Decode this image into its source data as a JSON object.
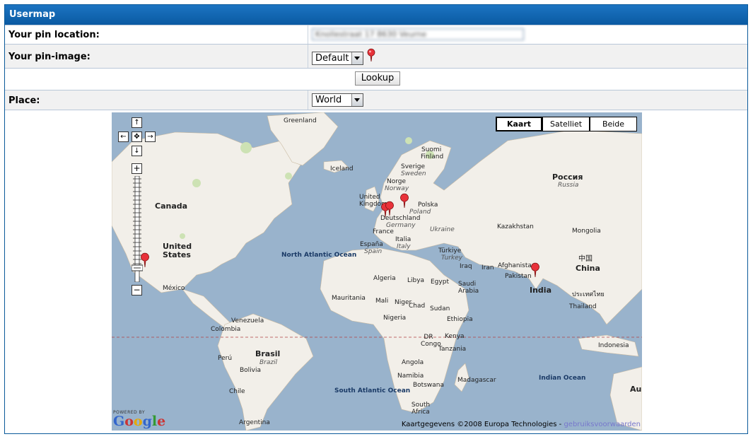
{
  "panel": {
    "title": "Usermap"
  },
  "form": {
    "pin_location_label": "Your pin location:",
    "pin_location_value": "Knollestraat 17 8630 Veurne",
    "pin_image_label": "Your pin-image:",
    "pin_image_selected": "Default",
    "lookup_label": "Lookup",
    "place_label": "Place:",
    "place_selected": "World"
  },
  "map": {
    "map_types": [
      "Kaart",
      "Satelliet",
      "Beide"
    ],
    "active_map_type": "Kaart",
    "credit": "Kaartgegevens ©2008 Europa Technologies - ",
    "credit_link": "gebruiksvoorwaarden",
    "powered_by": "POWERED BY",
    "google": "Google",
    "labels": {
      "greenland": "Greenland",
      "iceland": "Iceland",
      "suomi": "Suomi",
      "finland": "Finland",
      "sverige": "Sverige",
      "sweden": "Sweden",
      "norge": "Norge",
      "norway": "Norway",
      "united_kingdom": "United Kingdom",
      "polska": "Polska",
      "poland": "Poland",
      "deutschland": "Deutschland",
      "germany": "Germany",
      "france": "France",
      "ukraine": "Ukraine",
      "italia": "Italia",
      "italy": "Italy",
      "espana": "España",
      "spain": "Spain",
      "turkiye": "Türkiye",
      "turkey": "Turkey",
      "rossiya": "Россия",
      "russia": "Russia",
      "kazakhstan": "Kazakhstan",
      "mongolia": "Mongolia",
      "china_cn": "中国",
      "china": "China",
      "canada": "Canada",
      "united_states": "United States",
      "mexico": "México",
      "north_atlantic": "North Atlantic Ocean",
      "algeria": "Algeria",
      "libya": "Libya",
      "egypt": "Egypt",
      "iraq": "Iraq",
      "iran": "Iran",
      "afghanistan": "Afghanistan",
      "pakistan": "Pakistan",
      "india": "India",
      "saudi_arabia": "Saudi Arabia",
      "mauritania": "Mauritania",
      "mali": "Mali",
      "niger": "Niger",
      "chad": "Chad",
      "sudan": "Sudan",
      "nigeria": "Nigeria",
      "ethiopia": "Ethiopia",
      "thailand_th": "ประเทศไทย",
      "thailand": "Thailand",
      "venezuela": "Venezuela",
      "colombia": "Colombia",
      "kenya": "Kenya",
      "dr_congo": "DR Congo",
      "tanzania": "Tanzania",
      "brasil": "Brasil",
      "brazil": "Brazil",
      "peru": "Perú",
      "bolivia": "Bolivia",
      "angola": "Angola",
      "namibia": "Namibia",
      "botswana": "Botswana",
      "madagascar": "Madagascar",
      "indonesia": "Indonesia",
      "indian_ocean": "Indian Ocean",
      "chile": "Chile",
      "south_atlantic": "South Atlantic Ocean",
      "south_africa": "South Africa",
      "argentina": "Argentina",
      "australia_partial": "Au"
    }
  },
  "colors": {
    "title_bar": "#0a5aa2",
    "water": "#99b3cc",
    "land": "#f2efe9",
    "pin": "#e8323a"
  }
}
